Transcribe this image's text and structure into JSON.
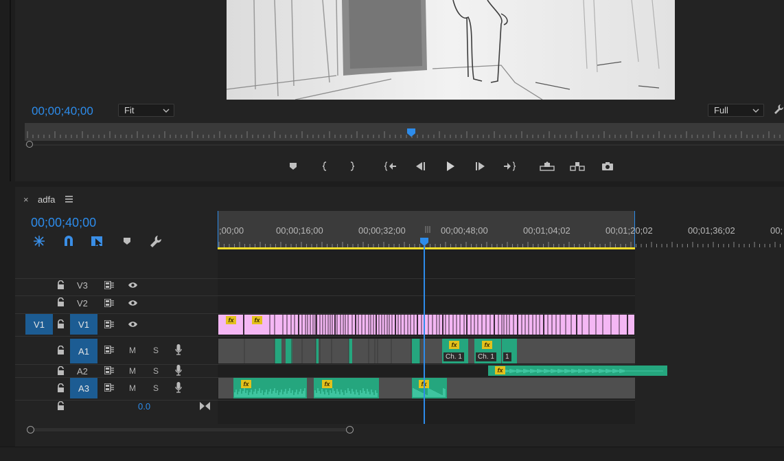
{
  "monitor": {
    "timecode": "00;00;40;00",
    "fit_dropdown": "Fit",
    "quality_dropdown": "Full",
    "playhead_position": 0.511
  },
  "transport": {
    "buttons": [
      "add-marker",
      "mark-in",
      "mark-out",
      "go-to-in",
      "step-back",
      "play",
      "step-forward",
      "go-to-out",
      "lift",
      "extract",
      "export-frame"
    ]
  },
  "timeline": {
    "tab_title": "adfa",
    "close_glyph": "×",
    "timecode": "00;00;40;00",
    "ruler_labels": [
      ";00;00",
      "00;00;16;00",
      "00;00;32;00",
      "00;00;48;00",
      "00;01;04;02",
      "00;01;20;02",
      "00;01;36;02",
      "00;"
    ],
    "tracks": {
      "V3": {
        "label": "V3"
      },
      "V2": {
        "label": "V2"
      },
      "V1": {
        "source": "V1",
        "label": "V1"
      },
      "A1": {
        "label": "A1",
        "mute": "M",
        "solo": "S"
      },
      "A2": {
        "label": "A2",
        "mute": "M",
        "solo": "S"
      },
      "A3": {
        "label": "A3",
        "mute": "M",
        "solo": "S"
      }
    },
    "master_volume": "0.0",
    "fx_label": "fx",
    "clip_labels": [
      "Ch. 1",
      "Ch. 1",
      "1"
    ]
  },
  "colors": {
    "accent_blue": "#2d8ceb",
    "video_clip": "#f4b7f4",
    "audio_clip": "#25a67e",
    "work_area": "#f0dc2a"
  }
}
